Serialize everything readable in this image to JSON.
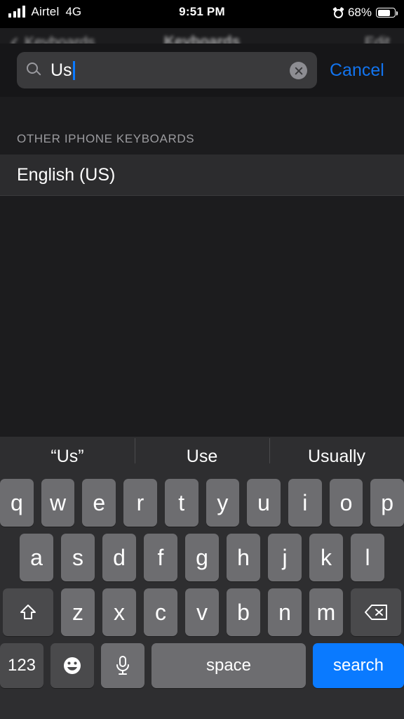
{
  "status_bar": {
    "carrier": "Airtel",
    "network": "4G",
    "time": "9:51 PM",
    "battery_percent": "68%",
    "signal_icon": "signal-bars-icon",
    "alarm_icon": "alarm-clock-icon",
    "battery_icon": "battery-icon"
  },
  "nav_bar": {
    "back_label": "Keyboards",
    "title": "Keyboards",
    "edit_label": "Edit",
    "back_icon": "chevron-left-icon"
  },
  "search": {
    "value": "Us",
    "placeholder": "Search",
    "cancel_label": "Cancel",
    "search_icon": "search-icon",
    "clear_icon": "clear-circle-icon",
    "caret_color": "#0a7aff",
    "cancel_color": "#1274ef"
  },
  "results": {
    "section_header": "OTHER IPHONE KEYBOARDS",
    "rows": [
      {
        "label": "English (US)"
      }
    ]
  },
  "keyboard": {
    "predictions": [
      "“Us”",
      "Use",
      "Usually"
    ],
    "row1": [
      "q",
      "w",
      "e",
      "r",
      "t",
      "y",
      "u",
      "i",
      "o",
      "p"
    ],
    "row2": [
      "a",
      "s",
      "d",
      "f",
      "g",
      "h",
      "j",
      "k",
      "l"
    ],
    "row3": [
      "z",
      "x",
      "c",
      "v",
      "b",
      "n",
      "m"
    ],
    "shift_icon": "shift-arrow-icon",
    "delete_icon": "backspace-icon",
    "numbers_label": "123",
    "emoji_icon": "emoji-smiley-icon",
    "dictation_icon": "microphone-icon",
    "space_label": "space",
    "return_label": "search",
    "return_key_color": "#0a7aff",
    "key_color": "#6d6d70",
    "function_key_color": "#4a4a4c",
    "keyboard_background": "#2e2e30"
  }
}
